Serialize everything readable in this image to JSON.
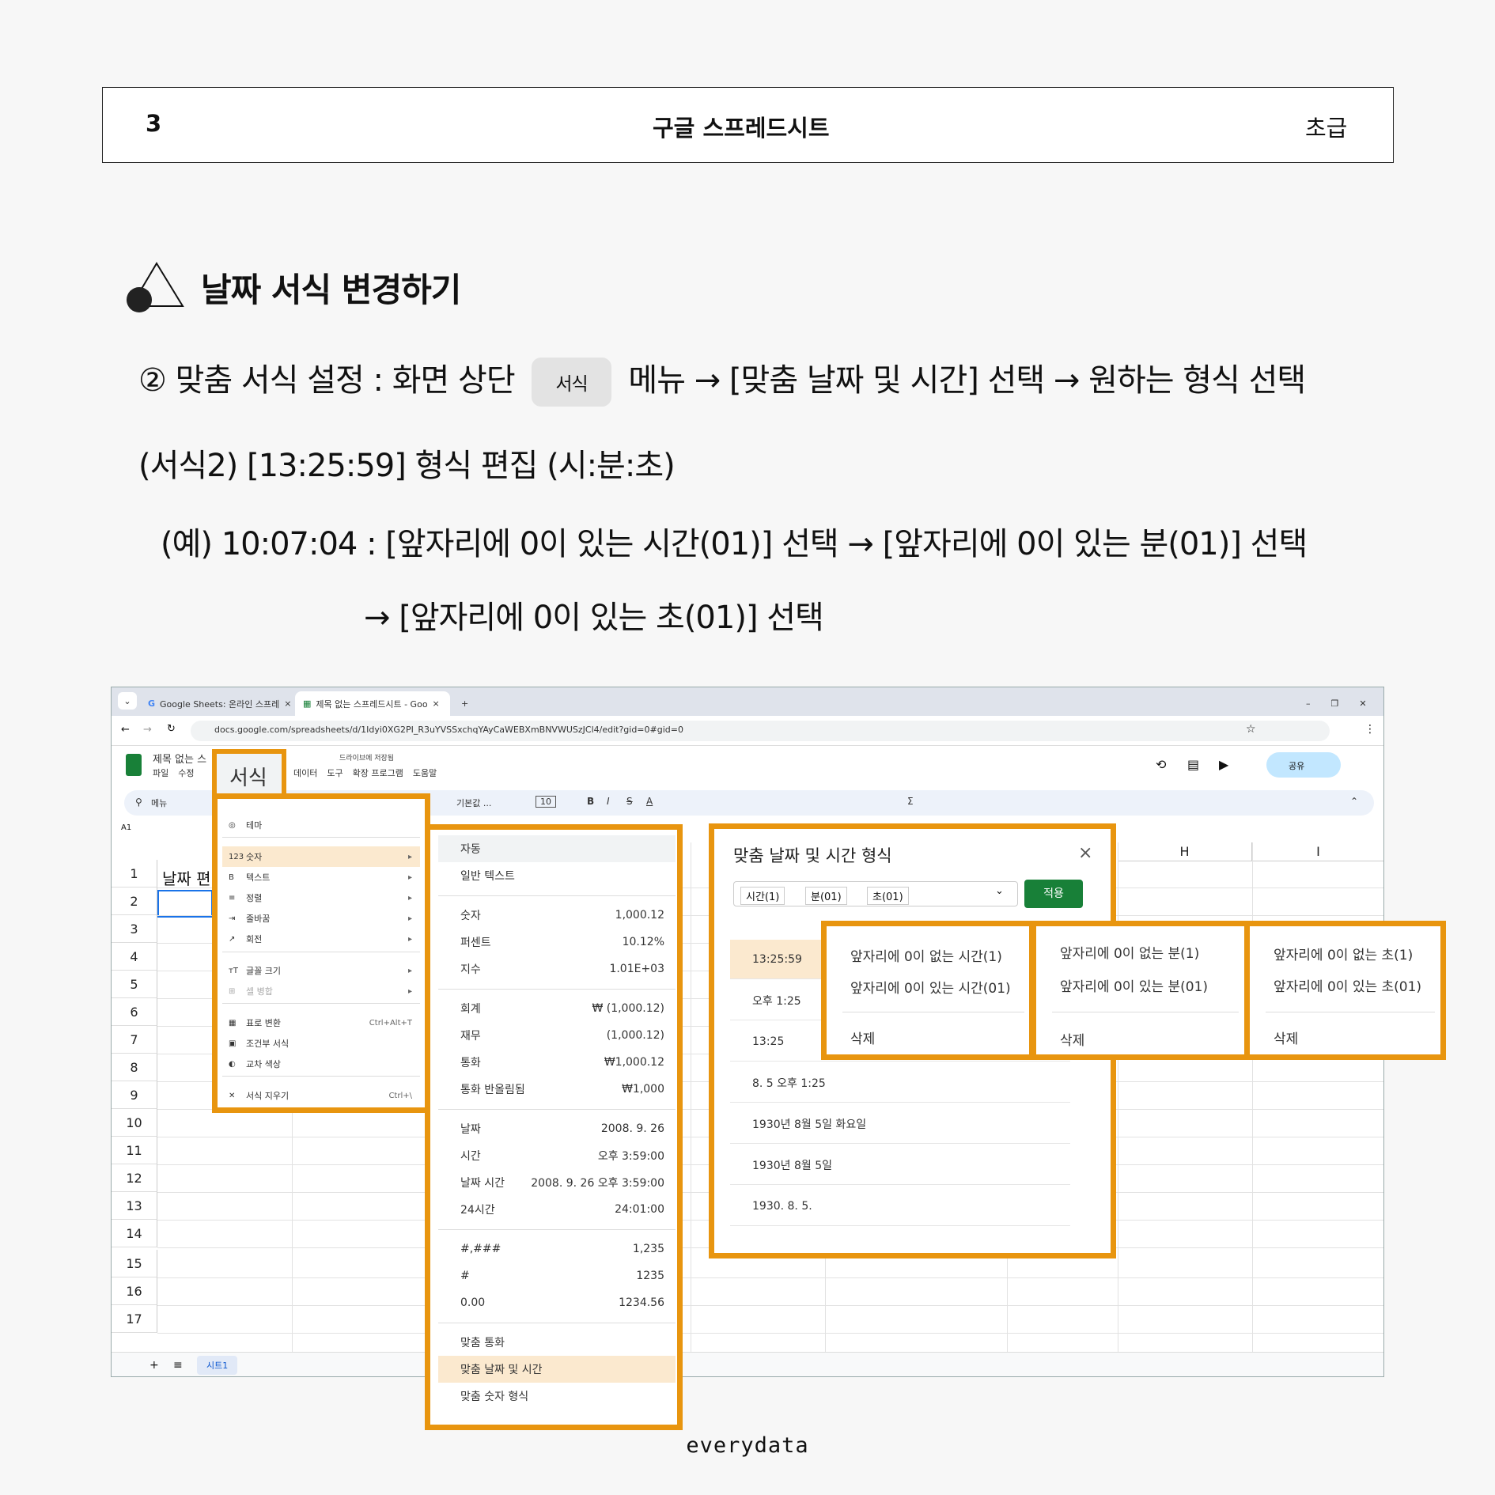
{
  "header": {
    "page_num": "3",
    "title": "구글 스프레드시트",
    "level": "초급"
  },
  "section_title": "날짜 서식 변경하기",
  "instructions": {
    "step_prefix": "② 맞춤 서식 설정 : 화면 상단",
    "chip": "서식",
    "step_suffix": "메뉴 → [맞춤 날짜 및 시간] 선택 → 원하는 형식 선택",
    "line2": "(서식2) [13:25:59] 형식 편집 (시:분:초)",
    "line3": "(예) 10:07:04 : [앞자리에 0이 있는 시간(01)] 선택 → [앞자리에 0이 있는 분(01)] 선택",
    "line4": "→ [앞자리에 0이 있는 초(01)] 선택"
  },
  "browser": {
    "tabs": [
      "Google Sheets: 온라인 스프레",
      "제목 없는 스프레드시트 - Goo"
    ],
    "url": "docs.google.com/spreadsheets/d/1Idyi0XG2PI_R3uYVSSxchqYAyCaWEBXmBNVWUSzJCl4/edit?gid=0#gid=0"
  },
  "app": {
    "doc_title": "제목 없는 스",
    "menus": [
      "파일",
      "수정",
      "데이터",
      "도구",
      "확장 프로그램",
      "도움말"
    ],
    "saved": "드라이브에 저장됨",
    "share": "공유",
    "format_menu": "서식",
    "search": "메뉴",
    "font": "기본값 ...",
    "font_size": "10",
    "cell_ref": "A1",
    "cell_a1": "날짜 편",
    "sheet_tab": "시트1"
  },
  "columns": [
    "H",
    "I"
  ],
  "rows": [
    "1",
    "2",
    "3",
    "4",
    "5",
    "6",
    "7",
    "8",
    "9",
    "10",
    "11",
    "12",
    "13",
    "14",
    "15",
    "16",
    "17"
  ],
  "format_menu_items": [
    {
      "label": "테마",
      "key": ""
    },
    {
      "label": "숫자",
      "key": "▸"
    },
    {
      "label": "텍스트",
      "key": "▸"
    },
    {
      "label": "정렬",
      "key": "▸"
    },
    {
      "label": "줄바꿈",
      "key": "▸"
    },
    {
      "label": "회전",
      "key": "▸"
    },
    {
      "label": "글꼴 크기",
      "key": "▸"
    },
    {
      "label": "셀 병합",
      "key": "▸"
    },
    {
      "label": "표로 변환",
      "key": "Ctrl+Alt+T"
    },
    {
      "label": "조건부 서식",
      "key": ""
    },
    {
      "label": "교차 색상",
      "key": ""
    },
    {
      "label": "서식 지우기",
      "key": "Ctrl+\\"
    }
  ],
  "number_menu_items": [
    {
      "label": "자동",
      "value": ""
    },
    {
      "label": "일반 텍스트",
      "value": ""
    },
    {
      "label": "숫자",
      "value": "1,000.12"
    },
    {
      "label": "퍼센트",
      "value": "10.12%"
    },
    {
      "label": "지수",
      "value": "1.01E+03"
    },
    {
      "label": "회계",
      "value": "₩ (1,000.12)"
    },
    {
      "label": "재무",
      "value": "(1,000.12)"
    },
    {
      "label": "통화",
      "value": "₩1,000.12"
    },
    {
      "label": "통화 반올림됨",
      "value": "₩1,000"
    },
    {
      "label": "날짜",
      "value": "2008. 9. 26"
    },
    {
      "label": "시간",
      "value": "오후 3:59:00"
    },
    {
      "label": "날짜 시간",
      "value": "2008. 9. 26 오후 3:59:00"
    },
    {
      "label": "24시간",
      "value": "24:01:00"
    },
    {
      "label": "#,###",
      "value": "1,235"
    },
    {
      "label": "#",
      "value": "1235"
    },
    {
      "label": "0.00",
      "value": "1234.56"
    },
    {
      "label": "맞춤 통화",
      "value": ""
    },
    {
      "label": "맞춤 날짜 및 시간",
      "value": ""
    },
    {
      "label": "맞춤 숫자 형식",
      "value": ""
    }
  ],
  "dialog": {
    "title": "맞춤 날짜 및 시간 형식",
    "close": "×",
    "tokens": [
      "시간(1)",
      "분(01)",
      "초(01)"
    ],
    "apply": "적용",
    "formats": [
      "13:25:59",
      "오후 1:25",
      "13:25",
      "8. 5 오후 1:25",
      "1930년 8월 5일 화요일",
      "1930년 8월 5일",
      "1930. 8. 5."
    ]
  },
  "hour_options": [
    "앞자리에 0이 없는 시간(1)",
    "앞자리에 0이 있는 시간(01)",
    "삭제"
  ],
  "minute_options": [
    "앞자리에 0이 없는 분(1)",
    "앞자리에 0이 있는 분(01)",
    "삭제"
  ],
  "second_options": [
    "앞자리에 0이 없는 초(1)",
    "앞자리에 0이 있는 초(01)",
    "삭제"
  ],
  "footer": "everydata",
  "colors": {
    "highlight": "#e8950f",
    "selected_bg": "#fbe9cf",
    "apply_btn": "#188038"
  }
}
